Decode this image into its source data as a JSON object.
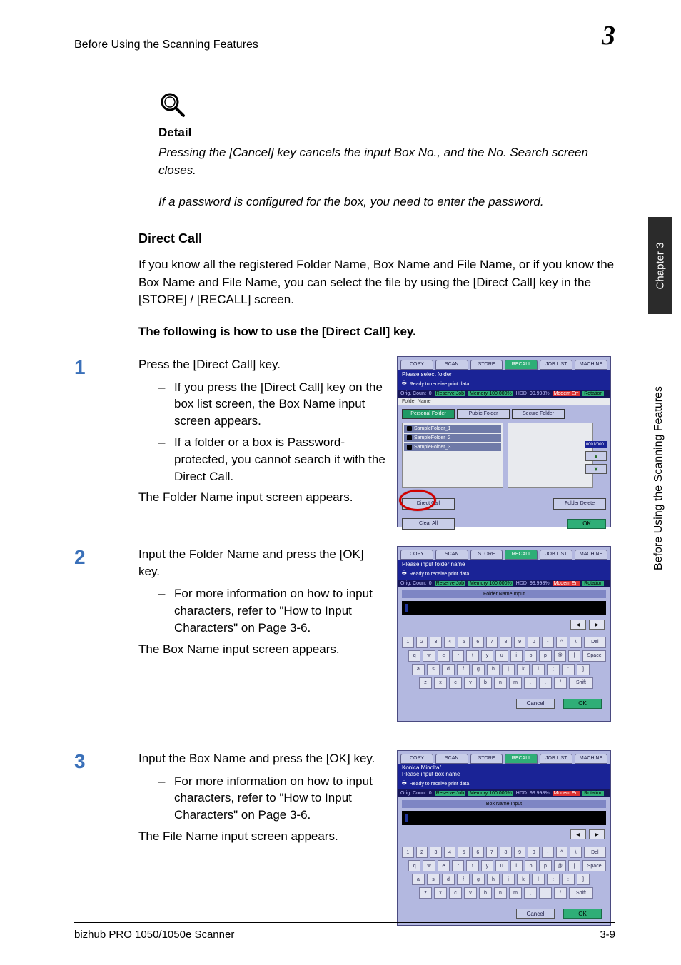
{
  "header": {
    "running_title": "Before Using the Scanning Features",
    "chapter_number": "3"
  },
  "sidebar": {
    "tab_label": "Chapter 3",
    "side_label": "Before Using the Scanning Features"
  },
  "detail": {
    "heading": "Detail",
    "para1": "Pressing the [Cancel] key cancels the input Box No., and the No. Search screen closes.",
    "para2": "If a password is configured for the box, you need to enter the password."
  },
  "section": {
    "direct_call_heading": "Direct Call",
    "direct_call_body": "If you know all the registered Folder Name, Box Name and File Name, or if you know the Box Name and File Name, you can select the file by using the [Direct Call] key in the [STORE] / [RECALL] screen.",
    "how_to_heading": "The following is how to use the [Direct Call] key."
  },
  "steps": {
    "s1": {
      "num": "1",
      "lead": "Press the [Direct Call] key.",
      "b1": "If you press the [Direct Call] key on the box list screen, the Box Name input screen appears.",
      "b2": "If a folder or a box is Password-protected, you cannot search it with the Direct Call.",
      "after": "The Folder Name input screen appears."
    },
    "s2": {
      "num": "2",
      "lead": "Input the Folder Name and press the [OK] key.",
      "b1": "For more information on how to input characters, refer to \"How to Input Characters\" on Page 3-6.",
      "after": "The Box Name input screen appears."
    },
    "s3": {
      "num": "3",
      "lead": "Input the Box Name and press the [OK] key.",
      "b1": "For more information on how to input characters, refer to \"How to Input Characters\" on Page 3-6.",
      "after": "The File Name input screen appears."
    }
  },
  "footer": {
    "product": "bizhub PRO 1050/1050e Scanner",
    "page": "3-9"
  },
  "shot_common": {
    "tabs": {
      "copy": "COPY",
      "scan": "SCAN",
      "store": "STORE",
      "recall": "RECALL",
      "jobhist": "JOB LIST",
      "machine": "MACHINE"
    },
    "status_ready": "Ready to receive print data",
    "status_line": {
      "orig": "Orig. Count",
      "count_val": "0",
      "reserve": "Reserve Job",
      "mem": "Memory 100.000%",
      "hdd": "HDD",
      "hdd_val": "99.998%",
      "modem": "Modem Err",
      "rot": "Rotation"
    },
    "ok": "OK",
    "cancel": "Cancel"
  },
  "shotA": {
    "title": "Please select folder",
    "col_header": "Folder Name",
    "folder_tabs": {
      "personal": "Personal Folder",
      "public": "Public Folder",
      "secure": "Secure Folder"
    },
    "rows": [
      "SampleFolder_1",
      "SampleFolder_2",
      "SampleFolder_3"
    ],
    "page_count": "0001/0001",
    "direct_call": "Direct Call",
    "folder_delete": "Folder Delete",
    "clear_all": "Clear All"
  },
  "shotB": {
    "title": "Please input folder name",
    "mid": "Folder Name Input",
    "keys_row1": [
      "1",
      "2",
      "3",
      "4",
      "5",
      "6",
      "7",
      "8",
      "9",
      "0",
      "-",
      "^",
      "\\",
      "Del"
    ],
    "keys_row2": [
      "q",
      "w",
      "e",
      "r",
      "t",
      "y",
      "u",
      "i",
      "o",
      "p",
      "@",
      "[",
      "",
      "Space"
    ],
    "keys_row3": [
      "a",
      "s",
      "d",
      "f",
      "g",
      "h",
      "j",
      "k",
      "l",
      ";",
      ":",
      "]"
    ],
    "keys_row4": [
      "z",
      "x",
      "c",
      "v",
      "b",
      "n",
      "m",
      ",",
      ".",
      "/",
      "",
      "Shift"
    ]
  },
  "shotC": {
    "crumb": "Konica Minolta/",
    "title": "Please input box name",
    "mid": "Box Name Input"
  }
}
